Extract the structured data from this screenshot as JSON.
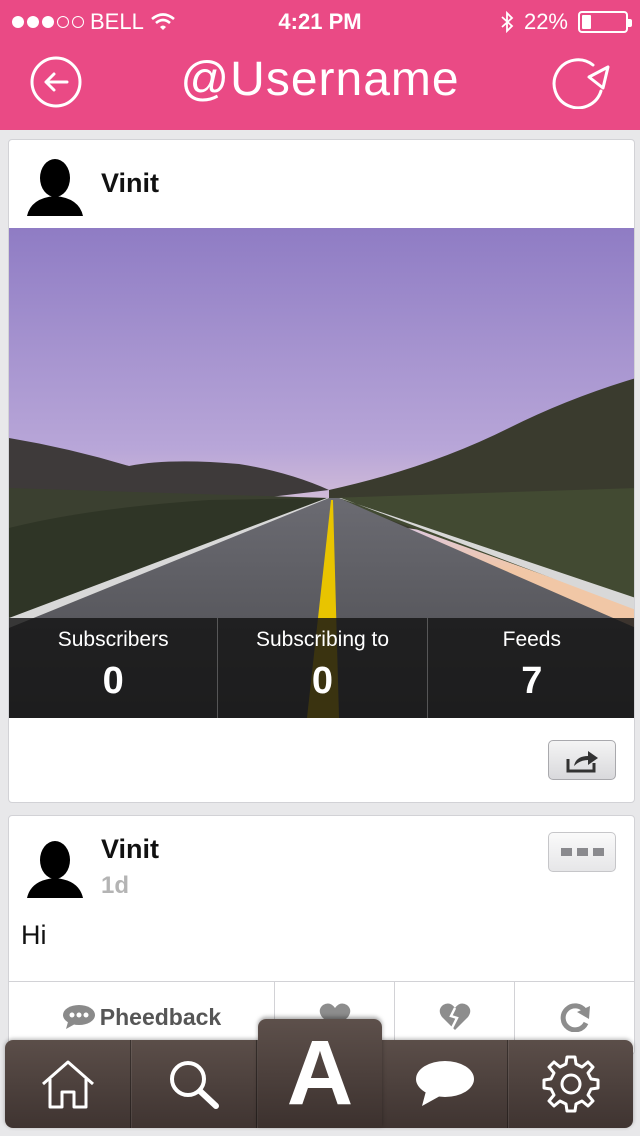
{
  "status_bar": {
    "carrier": "BELL",
    "time": "4:21 PM",
    "battery": "22%",
    "battery_level": 0.22
  },
  "header": {
    "title": "@Username",
    "back_icon": "back-arrow-circle-icon",
    "refresh_icon": "refresh-icon"
  },
  "profile_card": {
    "user_name": "Vinit",
    "stats": [
      {
        "label": "Subscribers",
        "value": "0"
      },
      {
        "label": "Subscribing to",
        "value": "0"
      },
      {
        "label": "Feeds",
        "value": "7"
      }
    ],
    "share_icon": "share-icon"
  },
  "post": {
    "user_name": "Vinit",
    "time": "1d",
    "text": "Hi",
    "actions": {
      "feedback_label": "Pheedback",
      "like_icon": "heart-icon",
      "dislike_icon": "broken-heart-icon",
      "repost_icon": "repost-icon"
    }
  },
  "tabbar": {
    "items": [
      {
        "name": "home",
        "icon": "home-icon"
      },
      {
        "name": "search",
        "icon": "search-icon"
      },
      {
        "name": "center",
        "label": "A"
      },
      {
        "name": "messages",
        "icon": "chat-bubble-icon"
      },
      {
        "name": "settings",
        "icon": "gear-icon"
      }
    ]
  },
  "colors": {
    "brand_pink": "#ea4a85",
    "tabbar_brown": "#4a3f3b"
  }
}
